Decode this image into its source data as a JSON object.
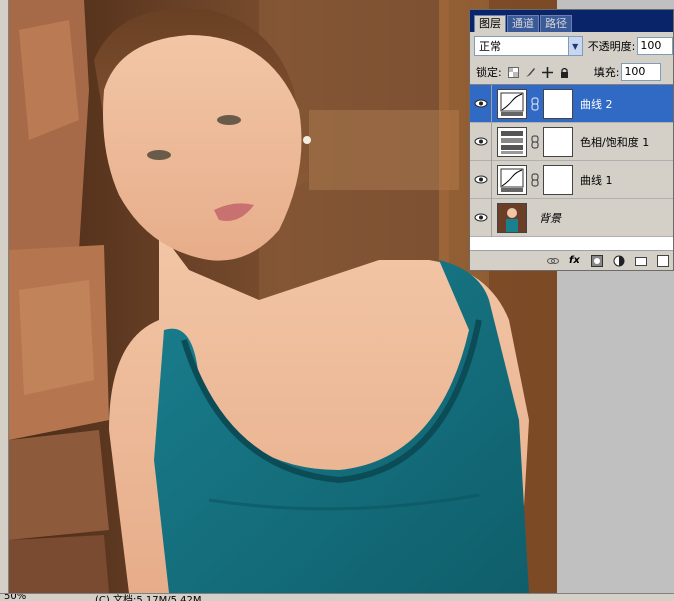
{
  "panel": {
    "tabs": [
      "图层",
      "通道",
      "路径"
    ],
    "blend_mode": "正常",
    "opacity_label": "不透明度:",
    "opacity_value": "100",
    "lock_label": "锁定:",
    "fill_label": "填充:",
    "fill_value": "100"
  },
  "layers": [
    {
      "name": "曲线 2",
      "type": "curves",
      "selected": true
    },
    {
      "name": "色相/饱和度 1",
      "type": "hue-saturation",
      "selected": false
    },
    {
      "name": "曲线 1",
      "type": "curves",
      "selected": false
    },
    {
      "name": "背景",
      "type": "background",
      "selected": false
    }
  ],
  "status": {
    "zoom": "50%",
    "doc_info": "(C) 文档:5.17M/5.42M"
  },
  "colors": {
    "selection": "#316ac5",
    "panel_bg": "#d4d0c8",
    "title_bar": "#0a246a",
    "dress": "#14707e"
  }
}
